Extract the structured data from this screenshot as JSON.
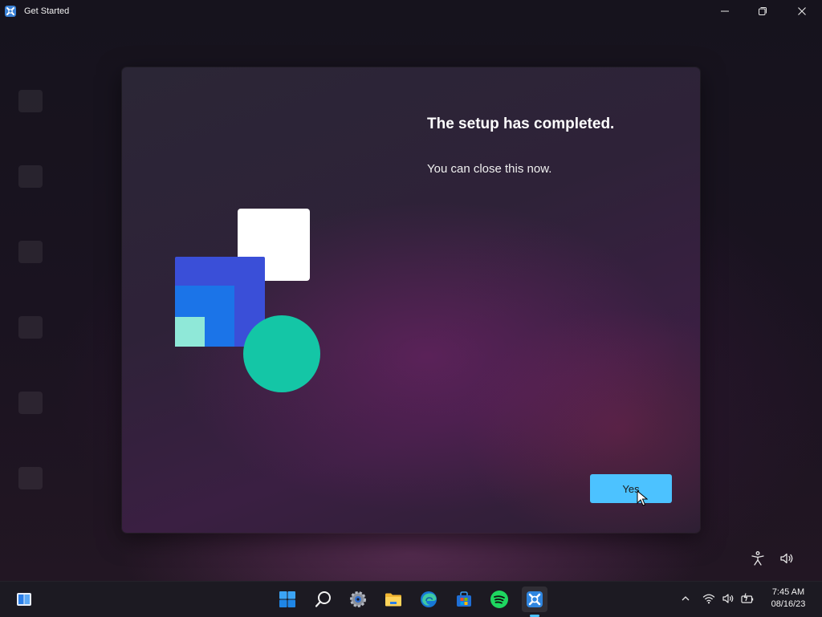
{
  "window": {
    "title": "Get Started",
    "icon": "get-started-app-icon"
  },
  "titlebar_buttons": [
    {
      "name": "minimize",
      "icon": "minimize-icon"
    },
    {
      "name": "restore",
      "icon": "restore-icon"
    },
    {
      "name": "close",
      "icon": "close-icon"
    }
  ],
  "dialog": {
    "heading": "The setup has completed.",
    "message": "You can close this now.",
    "primary_button": "Yes",
    "illustration": "windows-shapes-illustration"
  },
  "corner_icons": [
    "accessibility-icon",
    "volume-icon"
  ],
  "taskbar": {
    "widgets_icon": "widgets-icon",
    "pinned": [
      {
        "name": "start",
        "icon": "windows-logo-icon"
      },
      {
        "name": "search",
        "icon": "search-icon"
      },
      {
        "name": "settings",
        "icon": "settings-gear-icon"
      },
      {
        "name": "file-explorer",
        "icon": "folder-icon"
      },
      {
        "name": "edge",
        "icon": "edge-icon"
      },
      {
        "name": "microsoft-store",
        "icon": "store-icon"
      },
      {
        "name": "spotify",
        "icon": "spotify-icon"
      },
      {
        "name": "get-started",
        "icon": "get-started-app-icon",
        "active": true
      }
    ],
    "tray": [
      "chevron-up-icon",
      "wifi-icon",
      "speaker-icon",
      "battery-icon"
    ],
    "clock": {
      "time": "7:45 AM",
      "date": "08/16/23"
    }
  },
  "colors": {
    "accent": "#4cc2ff",
    "taskbar": "#1c1a22",
    "illustration_blue": "#1d63e6",
    "illustration_teal": "#18c6a8"
  }
}
